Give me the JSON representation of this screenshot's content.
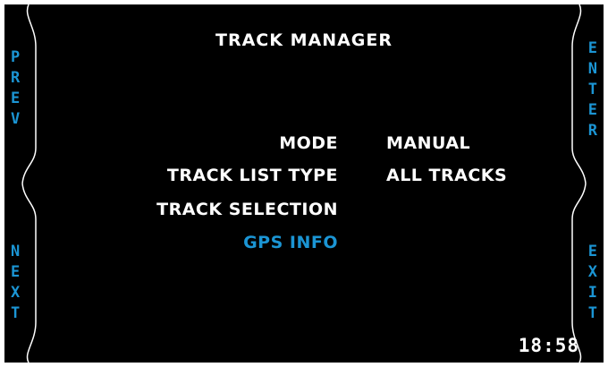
{
  "screen": {
    "title": "TRACK MANAGER",
    "accent_color": "#1b95d4",
    "text_color": "#ffffff",
    "background_color": "#000000"
  },
  "softkeys": {
    "prev": [
      "P",
      "R",
      "E",
      "V"
    ],
    "next": [
      "N",
      "E",
      "X",
      "T"
    ],
    "enter": [
      "E",
      "N",
      "T",
      "E",
      "R"
    ],
    "exit": [
      "E",
      "X",
      "I",
      "T"
    ]
  },
  "menu": [
    {
      "label": "MODE",
      "value": "MANUAL",
      "selected": false
    },
    {
      "label": "TRACK LIST TYPE",
      "value": "ALL TRACKS",
      "selected": false
    },
    {
      "label": "TRACK SELECTION",
      "value": "",
      "selected": false
    },
    {
      "label": "GPS INFO",
      "value": "",
      "selected": true
    }
  ],
  "status": {
    "clock": "18:58"
  }
}
